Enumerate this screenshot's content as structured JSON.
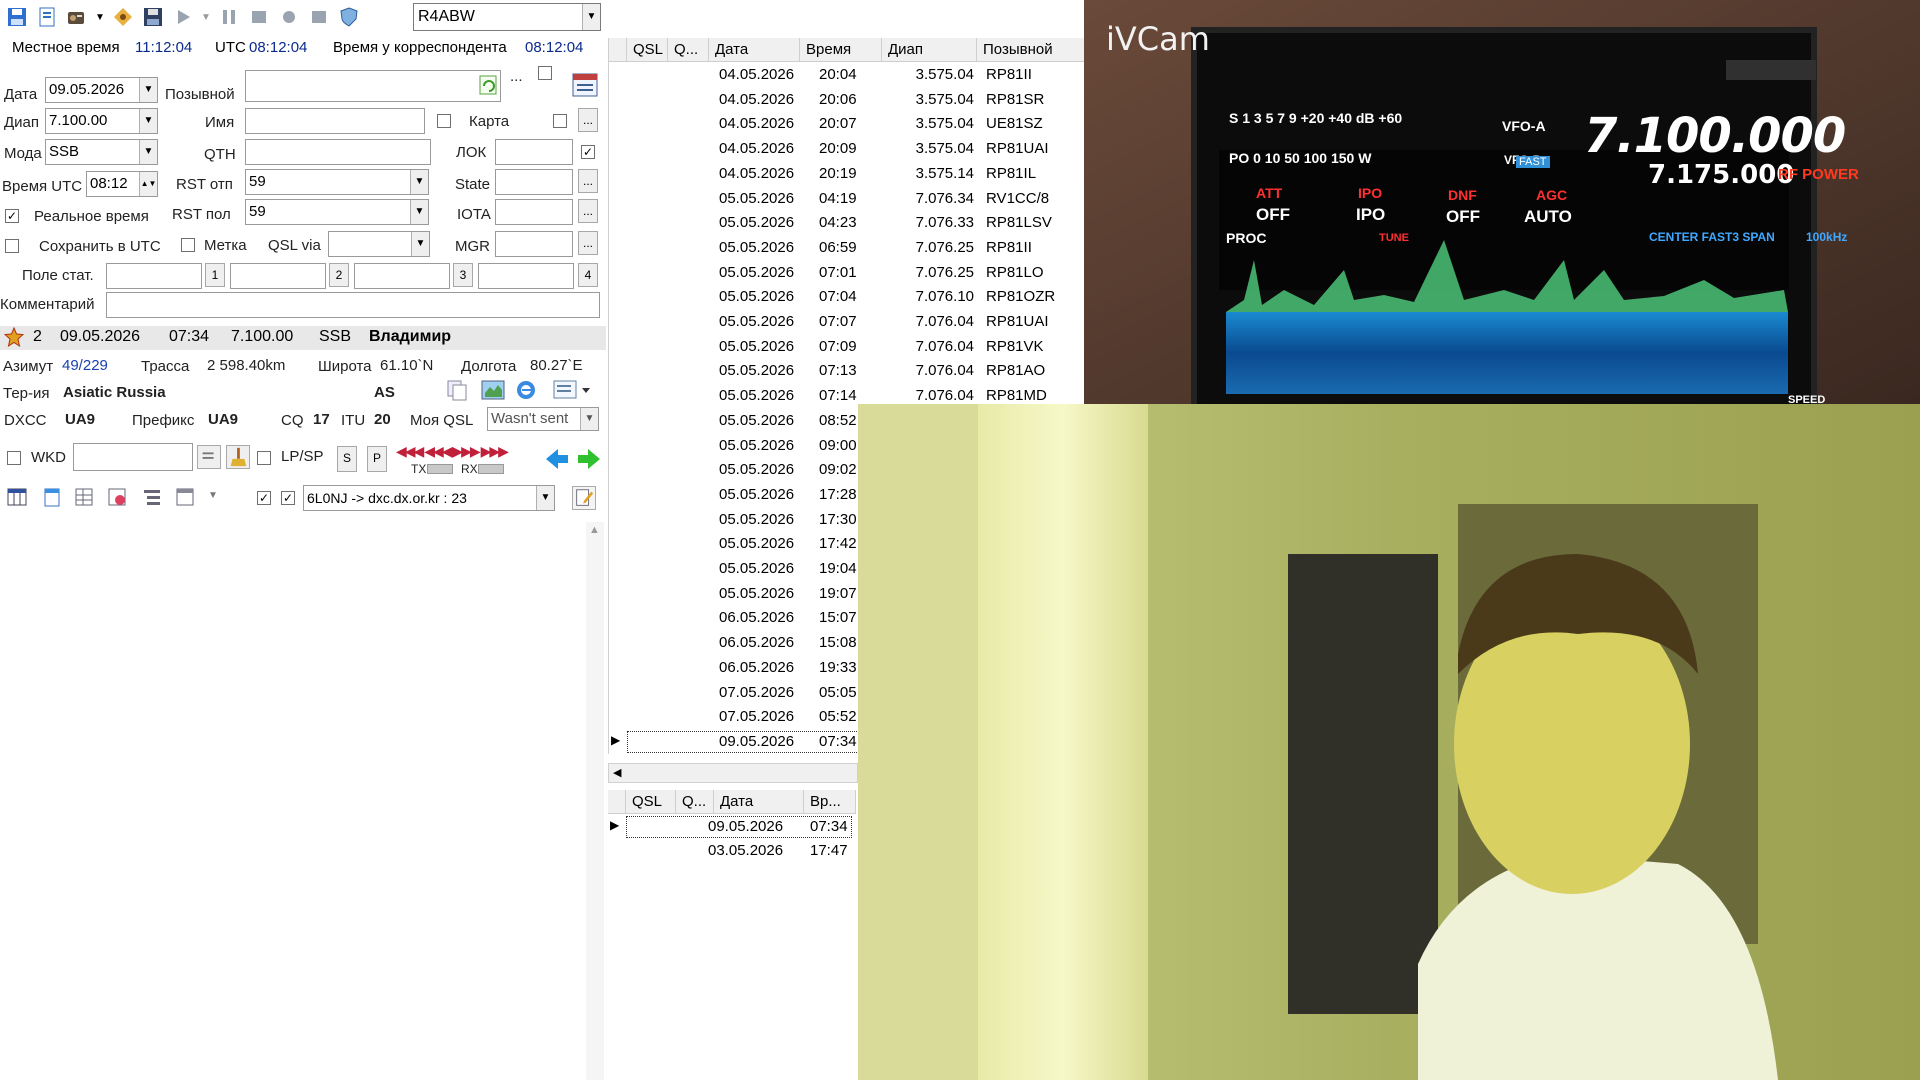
{
  "toolbar": {
    "callsign_select": "R4ABW"
  },
  "times": {
    "local_label": "Местное время",
    "local_value": "11:12:04",
    "utc_label": "UTC",
    "utc_value": "08:12:04",
    "corr_label": "Время у корреспондента",
    "corr_value": "08:12:04"
  },
  "form": {
    "date_label": "Дата",
    "date_value": "09.05.2026",
    "callsign_label": "Позывной",
    "callsign_value": "",
    "band_label": "Диап",
    "band_value": "7.100.00",
    "name_label": "Имя",
    "name_value": "",
    "map_label": "Карта",
    "mode_label": "Мода",
    "mode_value": "SSB",
    "qth_label": "QTH",
    "qth_value": "",
    "loc_label": "ЛОК",
    "loc_value": "",
    "time_utc_label": "Время UTC",
    "time_utc_value": "08:12",
    "rst_sent_label": "RST отп",
    "rst_sent_value": "59",
    "state_label": "State",
    "state_value": "",
    "realtime_label": "Реальное время",
    "rst_rcvd_label": "RST пол",
    "rst_rcvd_value": "59",
    "iota_label": "IOTA",
    "iota_value": "",
    "save_utc_label": "Сохранить в UTC",
    "mark_label": "Метка",
    "qslvia_label": "QSL via",
    "qslvia_value": "",
    "mgr_label": "MGR",
    "mgr_value": "",
    "stat_label": "Поле стат.",
    "stat_btn1": "1",
    "stat_btn2": "2",
    "stat_btn3": "3",
    "stat_btn4": "4",
    "comment_label": "Комментарий",
    "comment_value": ""
  },
  "info": {
    "count": "2",
    "date": "09.05.2026",
    "time": "07:34",
    "freq": "7.100.00",
    "mode": "SSB",
    "name": "Владимир",
    "azimuth_label": "Азимут",
    "azimuth_value": "49/229",
    "path_label": "Трасса",
    "path_value": "2 598.40km",
    "lat_label": "Широта",
    "lat_value": "61.10`N",
    "lon_label": "Долгота",
    "lon_value": "80.27`E",
    "territory_label": "Тер-ия",
    "territory_value": "Asiatic Russia",
    "continent": "AS",
    "dxcc_label": "DXCC",
    "dxcc_value": "UA9",
    "prefix_label": "Префикс",
    "prefix_value": "UA9",
    "cq_label": "CQ",
    "cq_value": "17",
    "itu_label": "ITU",
    "itu_value": "20",
    "myqsl_label": "Моя QSL",
    "myqsl_value": "Wasn't sent"
  },
  "wkd_bar": {
    "wkd_label": "WKD",
    "wkd_value": "",
    "lpsp_label": "LP/SP",
    "s_btn": "S",
    "p_btn": "P",
    "tx_label": "TX",
    "rx_label": "RX"
  },
  "cluster": {
    "value": "6L0NJ -> dxc.dx.or.kr : 23"
  },
  "log_grid": {
    "headers": [
      "QSL",
      "Q...",
      "Дата",
      "Время",
      "Диап",
      "Позывной"
    ],
    "rows": [
      [
        "04.05.2026",
        "20:04",
        "3.575.04",
        "RP81II"
      ],
      [
        "04.05.2026",
        "20:06",
        "3.575.04",
        "RP81SR"
      ],
      [
        "04.05.2026",
        "20:07",
        "3.575.04",
        "UE81SZ"
      ],
      [
        "04.05.2026",
        "20:09",
        "3.575.04",
        "RP81UAI"
      ],
      [
        "04.05.2026",
        "20:19",
        "3.575.14",
        "RP81IL"
      ],
      [
        "05.05.2026",
        "04:19",
        "7.076.34",
        "RV1CC/8"
      ],
      [
        "05.05.2026",
        "04:23",
        "7.076.33",
        "RP81LSV"
      ],
      [
        "05.05.2026",
        "06:59",
        "7.076.25",
        "RP81II"
      ],
      [
        "05.05.2026",
        "07:01",
        "7.076.25",
        "RP81LO"
      ],
      [
        "05.05.2026",
        "07:04",
        "7.076.10",
        "RP81OZR"
      ],
      [
        "05.05.2026",
        "07:07",
        "7.076.04",
        "RP81UAI"
      ],
      [
        "05.05.2026",
        "07:09",
        "7.076.04",
        "RP81VK"
      ],
      [
        "05.05.2026",
        "07:13",
        "7.076.04",
        "RP81AO"
      ],
      [
        "05.05.2026",
        "07:14",
        "7.076.04",
        "RP81MD"
      ],
      [
        "05.05.2026",
        "08:52",
        "",
        ""
      ],
      [
        "05.05.2026",
        "09:00",
        "",
        ""
      ],
      [
        "05.05.2026",
        "09:02",
        "",
        ""
      ],
      [
        "05.05.2026",
        "17:28",
        "",
        ""
      ],
      [
        "05.05.2026",
        "17:30",
        "",
        ""
      ],
      [
        "05.05.2026",
        "17:42",
        "",
        ""
      ],
      [
        "05.05.2026",
        "19:04",
        "",
        ""
      ],
      [
        "05.05.2026",
        "19:07",
        "",
        ""
      ],
      [
        "06.05.2026",
        "15:07",
        "",
        ""
      ],
      [
        "06.05.2026",
        "15:08",
        "",
        ""
      ],
      [
        "06.05.2026",
        "19:33",
        "",
        ""
      ],
      [
        "07.05.2026",
        "05:05",
        "",
        ""
      ],
      [
        "07.05.2026",
        "05:52",
        "",
        ""
      ],
      [
        "09.05.2026",
        "07:34",
        "",
        ""
      ]
    ]
  },
  "log_grid2": {
    "headers": [
      "QSL",
      "Q...",
      "Дата",
      "Вр..."
    ],
    "rows": [
      [
        "09.05.2026",
        "07:34"
      ],
      [
        "03.05.2026",
        "17:47"
      ]
    ]
  },
  "radio_display": {
    "watermark": "iVCam",
    "freq_a": "7.100.000",
    "freq_b": "7.175.000",
    "vfo_a": "VFO-A",
    "vfo_b": "VFO-B",
    "rf_power": "RF POWER",
    "att_label": "ATT",
    "att_value": "OFF",
    "ipo_label": "IPO",
    "ipo_value": "IPO",
    "dnf_label": "DNF",
    "dnf_value": "OFF",
    "agc_label": "AGC",
    "agc_value": "AUTO",
    "proc": "PROC",
    "tune": "TUNE",
    "scope_mode": "CENTER FAST3 SPAN",
    "span": "100kHz",
    "fast": "FAST",
    "s_scale": "S 1 3 5 7 9 +20 +40 dB +60",
    "po_scale": "PO 0 10 50 100 150 W",
    "speed": "SPEED"
  }
}
